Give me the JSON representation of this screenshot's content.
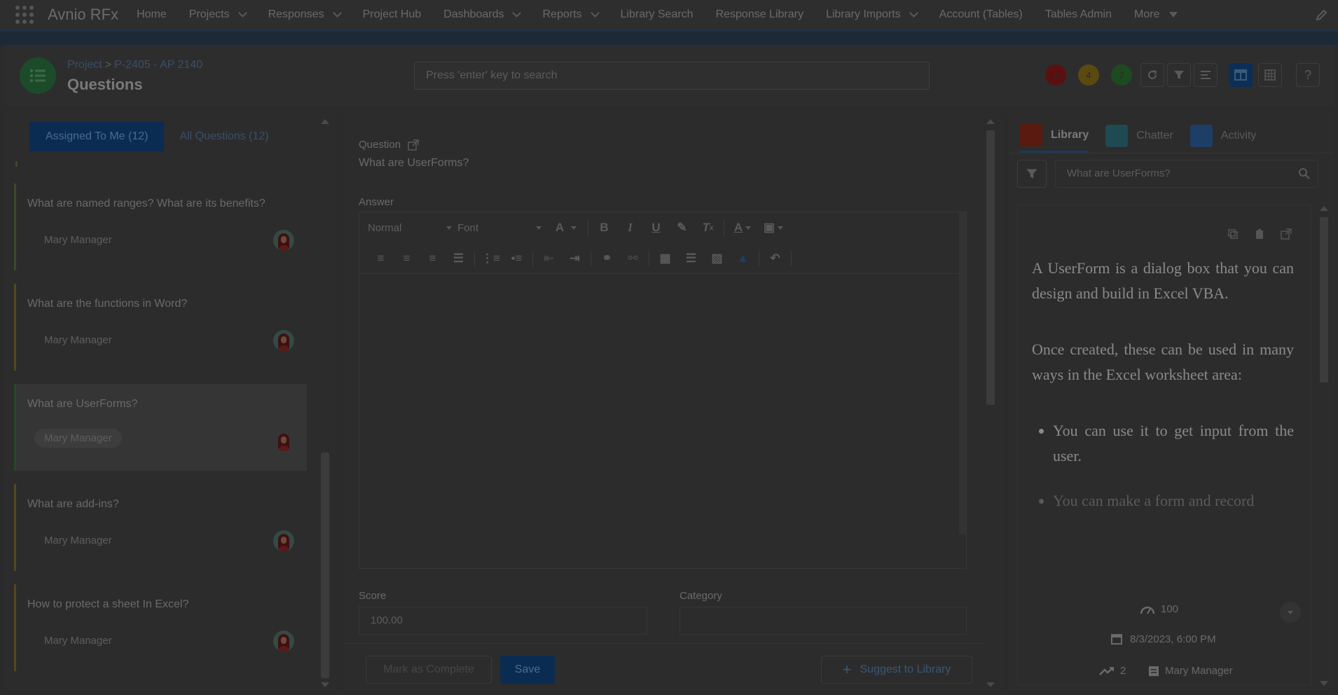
{
  "nav": {
    "app_name": "Avnio RFx",
    "items": [
      {
        "label": "Home",
        "dropdown": false
      },
      {
        "label": "Projects",
        "dropdown": true
      },
      {
        "label": "Responses",
        "dropdown": true
      },
      {
        "label": "Project Hub",
        "dropdown": false
      },
      {
        "label": "Dashboards",
        "dropdown": true
      },
      {
        "label": "Reports",
        "dropdown": true
      },
      {
        "label": "Library Search",
        "dropdown": false
      },
      {
        "label": "Response Library",
        "dropdown": false
      },
      {
        "label": "Library Imports",
        "dropdown": true
      },
      {
        "label": "Account (Tables)",
        "dropdown": false
      },
      {
        "label": "Tables Admin",
        "dropdown": false
      },
      {
        "label": "More",
        "dropdown": true
      }
    ]
  },
  "header": {
    "breadcrumb_project": "Project",
    "breadcrumb_sep": ">",
    "breadcrumb_id": "P-2405 - AP 2140",
    "title": "Questions",
    "search_placeholder": "Press 'enter' key to search",
    "status": [
      {
        "value": "1",
        "color": "#5a1010"
      },
      {
        "value": "4",
        "color": "#5a4a10"
      },
      {
        "value": "7",
        "color": "#1d4a1f"
      }
    ]
  },
  "left": {
    "tab_assigned": "Assigned To Me (12)",
    "tab_all": "All Questions (12)",
    "questions": [
      {
        "text": "What are named ranges? What are its benefits?",
        "owner": "Mary Manager",
        "status": "green"
      },
      {
        "text": "What are the functions in Word?",
        "owner": "Mary Manager",
        "status": "yellow"
      },
      {
        "text": "What are UserForms?",
        "owner": "Mary Manager",
        "status": "selected"
      },
      {
        "text": "What are add-ins?",
        "owner": "Mary Manager",
        "status": "yellow"
      },
      {
        "text": "How to protect a sheet In Excel?",
        "owner": "Mary Manager",
        "status": "yellow"
      }
    ]
  },
  "middle": {
    "question_label": "Question",
    "question_value": "What are UserForms?",
    "answer_label": "Answer",
    "style_select": "Normal",
    "font_select": "Font",
    "score_label": "Score",
    "score_value": "100.00",
    "category_label": "Category",
    "category_value": "",
    "mark_complete": "Mark as Complete",
    "save": "Save",
    "suggest": "Suggest to Library"
  },
  "right": {
    "tabs": [
      "Library",
      "Chatter",
      "Activity"
    ],
    "search_value": "What are UserForms?",
    "answer_p1": "A UserForm is a dialog box that you can design and build in Excel VBA.",
    "answer_p2": "Once created, these can be used in many ways in the Excel worksheet area:",
    "answer_li1": "You can use it to get input from the user.",
    "answer_li2": "You can make a form and record",
    "score": "100",
    "date": "8/3/2023, 6:00 PM",
    "uses": "2",
    "owner": "Mary Manager"
  }
}
